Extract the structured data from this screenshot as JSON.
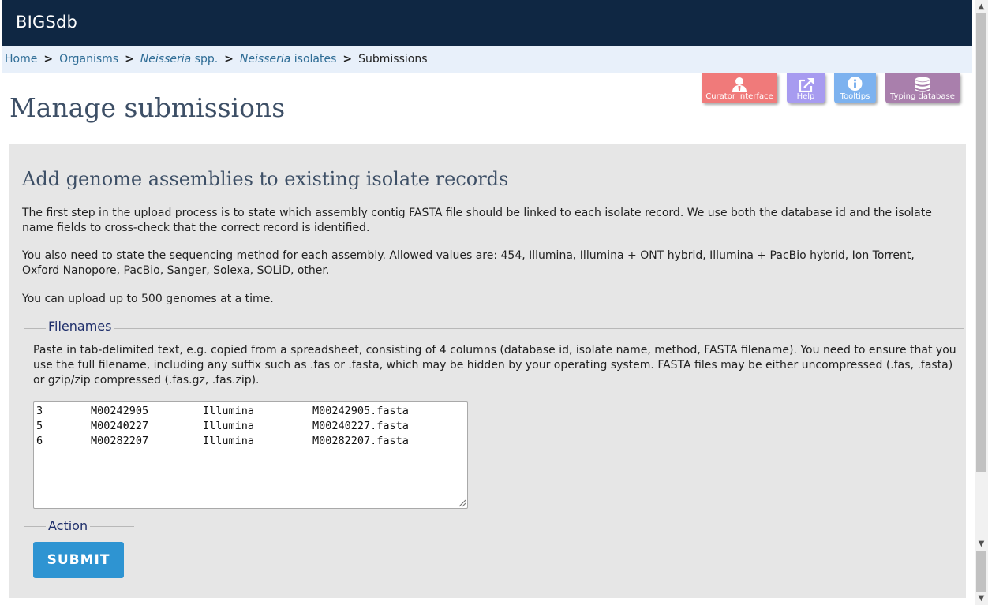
{
  "header": {
    "brand": "BIGSdb"
  },
  "breadcrumb": {
    "home": "Home",
    "organisms": "Organisms",
    "species_italic": "Neisseria",
    "species_rest": " spp.",
    "isolates_italic": "Neisseria",
    "isolates_rest": " isolates",
    "current": "Submissions",
    "separator": ">"
  },
  "page": {
    "title": "Manage submissions"
  },
  "toolbar": {
    "curator_label": "Curator interface",
    "help_label": "Help",
    "tooltips_label": "Tooltips",
    "typing_label": "Typing database"
  },
  "panel": {
    "heading": "Add genome assemblies to existing isolate records",
    "para1": "The first step in the upload process is to state which assembly contig FASTA file should be linked to each isolate record. We use both the database id and the isolate name fields to cross-check that the correct record is identified.",
    "para2": "You also need to state the sequencing method for each assembly. Allowed values are: 454, Illumina, Illumina + ONT hybrid, Illumina + PacBio hybrid, Ion Torrent, Oxford Nanopore, PacBio, Sanger, Solexa, SOLiD, other.",
    "para3": "You can upload up to 500 genomes at a time.",
    "filenames_legend": "Filenames",
    "filenames_note": "Paste in tab-delimited text, e.g. copied from a spreadsheet, consisting of 4 columns (database id, isolate name, method, FASTA filename). You need to ensure that you use the full filename, including any suffix such as .fas or .fasta, which may be hidden by your operating system. FASTA files may be either uncompressed (.fas, .fasta) or gzip/zip compressed (.fas.gz, .fas.zip).",
    "rows": [
      {
        "id": "3",
        "name": "M00242905",
        "method": "Illumina",
        "file": "M00242905.fasta"
      },
      {
        "id": "5",
        "name": "M00240227",
        "method": "Illumina",
        "file": "M00240227.fasta"
      },
      {
        "id": "6",
        "name": "M00282207",
        "method": "Illumina",
        "file": "M00282207.fasta"
      }
    ],
    "action_legend": "Action",
    "submit_label": "SUBMIT"
  },
  "colors": {
    "header_bg": "#0f2743",
    "breadcrumb_bg": "#e8f0fa",
    "link": "#2f6d96",
    "curator": "#f07a7a",
    "help": "#a79bf0",
    "tooltips": "#7db2ef",
    "typing": "#a97fac",
    "submit": "#2e94d2"
  },
  "icons": {
    "curator": "curator-user-icon",
    "help": "external-link-icon",
    "tooltips": "info-icon",
    "typing": "database-icon"
  }
}
